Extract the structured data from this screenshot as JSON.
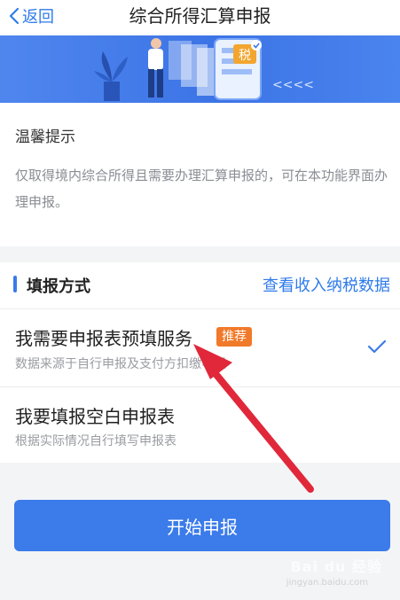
{
  "nav": {
    "back_label": "返回",
    "title": "综合所得汇算申报"
  },
  "banner": {
    "tax_char": "税",
    "chevrons": "<<<<"
  },
  "tip": {
    "title": "温馨提示",
    "body": "仅取得境内综合所得且需要办理汇算申报的，可在本功能界面办理申报。"
  },
  "method": {
    "section_title": "填报方式",
    "view_link": "查看收入纳税数据",
    "options": [
      {
        "title": "我需要申报表预填服务",
        "badge": "推荐",
        "subtitle": "数据来源于自行申报及支付方扣缴申报",
        "selected": true
      },
      {
        "title": "我要填报空白申报表",
        "subtitle": "根据实际情况自行填写申报表",
        "selected": false
      }
    ]
  },
  "start_button": "开始申报",
  "watermark": {
    "text": "Bai du 经验",
    "sub": "jingyan.baidu.com"
  },
  "colors": {
    "accent": "#3b7bea",
    "badge": "#f1792a",
    "annotation_arrow": "#e0283a"
  }
}
